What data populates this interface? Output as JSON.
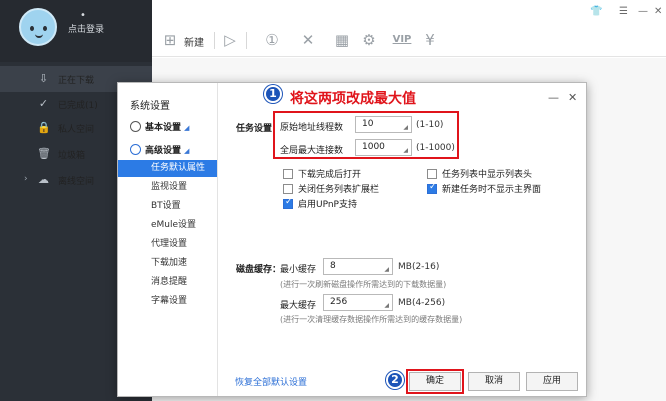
{
  "sidebar": {
    "user_label": "点击登录",
    "user_dot": "•",
    "items": [
      {
        "icon": "download-arrow-icon",
        "glyph": "⇩",
        "label": "正在下载"
      },
      {
        "icon": "check-circle-icon",
        "glyph": "✓",
        "label": "已完成(1)"
      },
      {
        "icon": "lock-icon",
        "glyph": "🔒",
        "label": "私人空间"
      },
      {
        "icon": "trash-icon",
        "glyph": "🗑",
        "label": "垃圾箱"
      },
      {
        "icon": "cloud-icon",
        "glyph": "☁",
        "label": "离线空间",
        "arrow": "›"
      }
    ]
  },
  "toolbar": {
    "new_label": "新建",
    "icons": [
      "plus-icon",
      "play-icon",
      "pause-icon",
      "delete-icon",
      "grid-icon",
      "gear-icon",
      "vip-icon",
      "yen-icon"
    ],
    "vip_text": "VIP"
  },
  "window_controls": [
    "shirt-icon",
    "menu-icon",
    "minimize-icon",
    "close-icon"
  ],
  "dialog": {
    "title": "系统设置",
    "categories": {
      "basic": "基本设置",
      "advanced": "高级设置"
    },
    "subitems": [
      {
        "label": "任务默认属性",
        "selected": true
      },
      {
        "label": "监视设置",
        "selected": false
      },
      {
        "label": "BT设置",
        "selected": false
      },
      {
        "label": "eMule设置",
        "selected": false
      },
      {
        "label": "代理设置",
        "selected": false
      },
      {
        "label": "下载加速",
        "selected": false
      },
      {
        "label": "消息提醒",
        "selected": false
      },
      {
        "label": "字幕设置",
        "selected": false
      }
    ],
    "annotation_1": "1",
    "annotation_text": "将这两项改成最大值",
    "annotation_2": "2",
    "task_settings_label": "任务设置",
    "origin_threads_label": "原始地址线程数",
    "origin_threads_value": "10",
    "origin_threads_range": "(1-10)",
    "max_connections_label": "全局最大连接数",
    "max_connections_value": "1000",
    "max_connections_range": "(1-1000)",
    "checkboxes": [
      {
        "label": "下载完成后打开",
        "checked": false
      },
      {
        "label": "任务列表中显示列表头",
        "checked": false
      },
      {
        "label": "关闭任务列表扩展栏",
        "checked": false
      },
      {
        "label": "新建任务时不显示主界面",
        "checked": true
      },
      {
        "label": "启用UPnP支持",
        "checked": true
      }
    ],
    "disk_cache_label": "磁盘缓存：",
    "min_cache_label": "最小缓存",
    "min_cache_value": "8",
    "min_cache_range": "MB(2-16)",
    "min_cache_hint": "(进行一次刷新磁盘操作所需达到的下载数据量)",
    "max_cache_label": "最大缓存",
    "max_cache_value": "256",
    "max_cache_range": "MB(4-256)",
    "max_cache_hint": "(进行一次清理缓存数据操作所需达到的缓存数据量)",
    "restore_defaults": "恢复全部默认设置",
    "ok_label": "确定",
    "cancel_label": "取消",
    "apply_label": "应用",
    "minimize_glyph": "—",
    "close_glyph": "✕"
  },
  "colors": {
    "sidebar_bg": "#2b3037",
    "selection_blue": "#2c7be5",
    "annotation_red": "#e0141b",
    "annotation_blue": "#1c54b8"
  }
}
